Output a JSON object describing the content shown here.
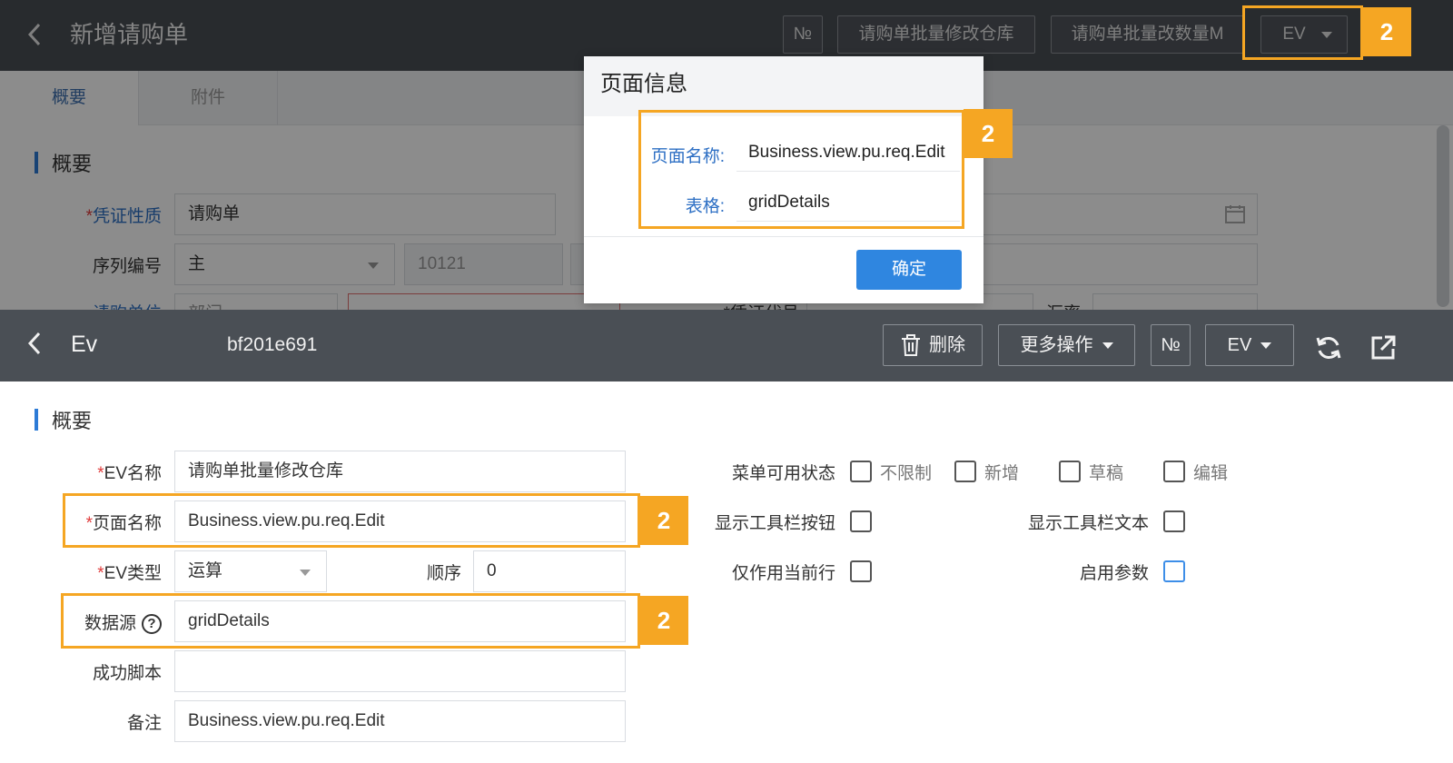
{
  "top_panel": {
    "back_icon": "chevron-left-icon",
    "title": "新增请购单",
    "buttons": [
      "№",
      "请购单批量修改仓库",
      "请购单批量改数量M",
      "EV"
    ],
    "tabs": [
      "概要",
      "附件"
    ],
    "section_title": "概要",
    "fields": [
      {
        "label": "凭证性质",
        "value": "请购单",
        "required": true
      },
      {
        "label": "序列编号",
        "value": "主"
      },
      {
        "value": "10121"
      }
    ],
    "partial_text": [
      "请购单位",
      "部门",
      "*凭证代号",
      "汇率"
    ],
    "dialog": {
      "title": "页面信息",
      "page_name_label": "页面名称:",
      "page_name_value": "Business.view.pu.req.Edit",
      "grid_label": "表格:",
      "grid_value": "gridDetails",
      "ok_label": "确定"
    },
    "badges": [
      "2",
      "2"
    ]
  },
  "bottom_panel": {
    "back_icon": "chevron-left-icon",
    "title": "Ev",
    "record_id": "bf201e691",
    "buttons": {
      "delete": "删除",
      "more": "更多操作",
      "number": "№",
      "ev": "EV"
    },
    "icons": [
      "trash-icon",
      "refresh-icon",
      "share-icon"
    ],
    "section_title": "概要",
    "form": {
      "ev_name": {
        "label": "EV名称",
        "value": "请购单批量修改仓库"
      },
      "page_name": {
        "label": "页面名称",
        "value": "Business.view.pu.req.Edit"
      },
      "ev_type": {
        "label": "EV类型",
        "value": "运算"
      },
      "order": {
        "label": "顺序",
        "value": "0"
      },
      "data_source": {
        "label": "数据源",
        "value": "gridDetails",
        "help": "?"
      },
      "success_script": {
        "label": "成功脚本",
        "value": ""
      },
      "remark": {
        "label": "备注",
        "value": "Business.view.pu.req.Edit"
      }
    },
    "options": {
      "menu_state_label": "菜单可用状态",
      "menu_states": [
        "不限制",
        "新增",
        "草稿",
        "编辑"
      ],
      "show_toolbar_button": "显示工具栏按钮",
      "show_toolbar_text": "显示工具栏文本",
      "current_row_only": "仅作用当前行",
      "enable_params": "启用参数"
    },
    "badges": [
      "2",
      "2"
    ]
  },
  "colors": {
    "header_bg": "#4a4f55",
    "highlight": "#f5a623",
    "primary": "#2f86e0",
    "required": "#e03b3b"
  }
}
